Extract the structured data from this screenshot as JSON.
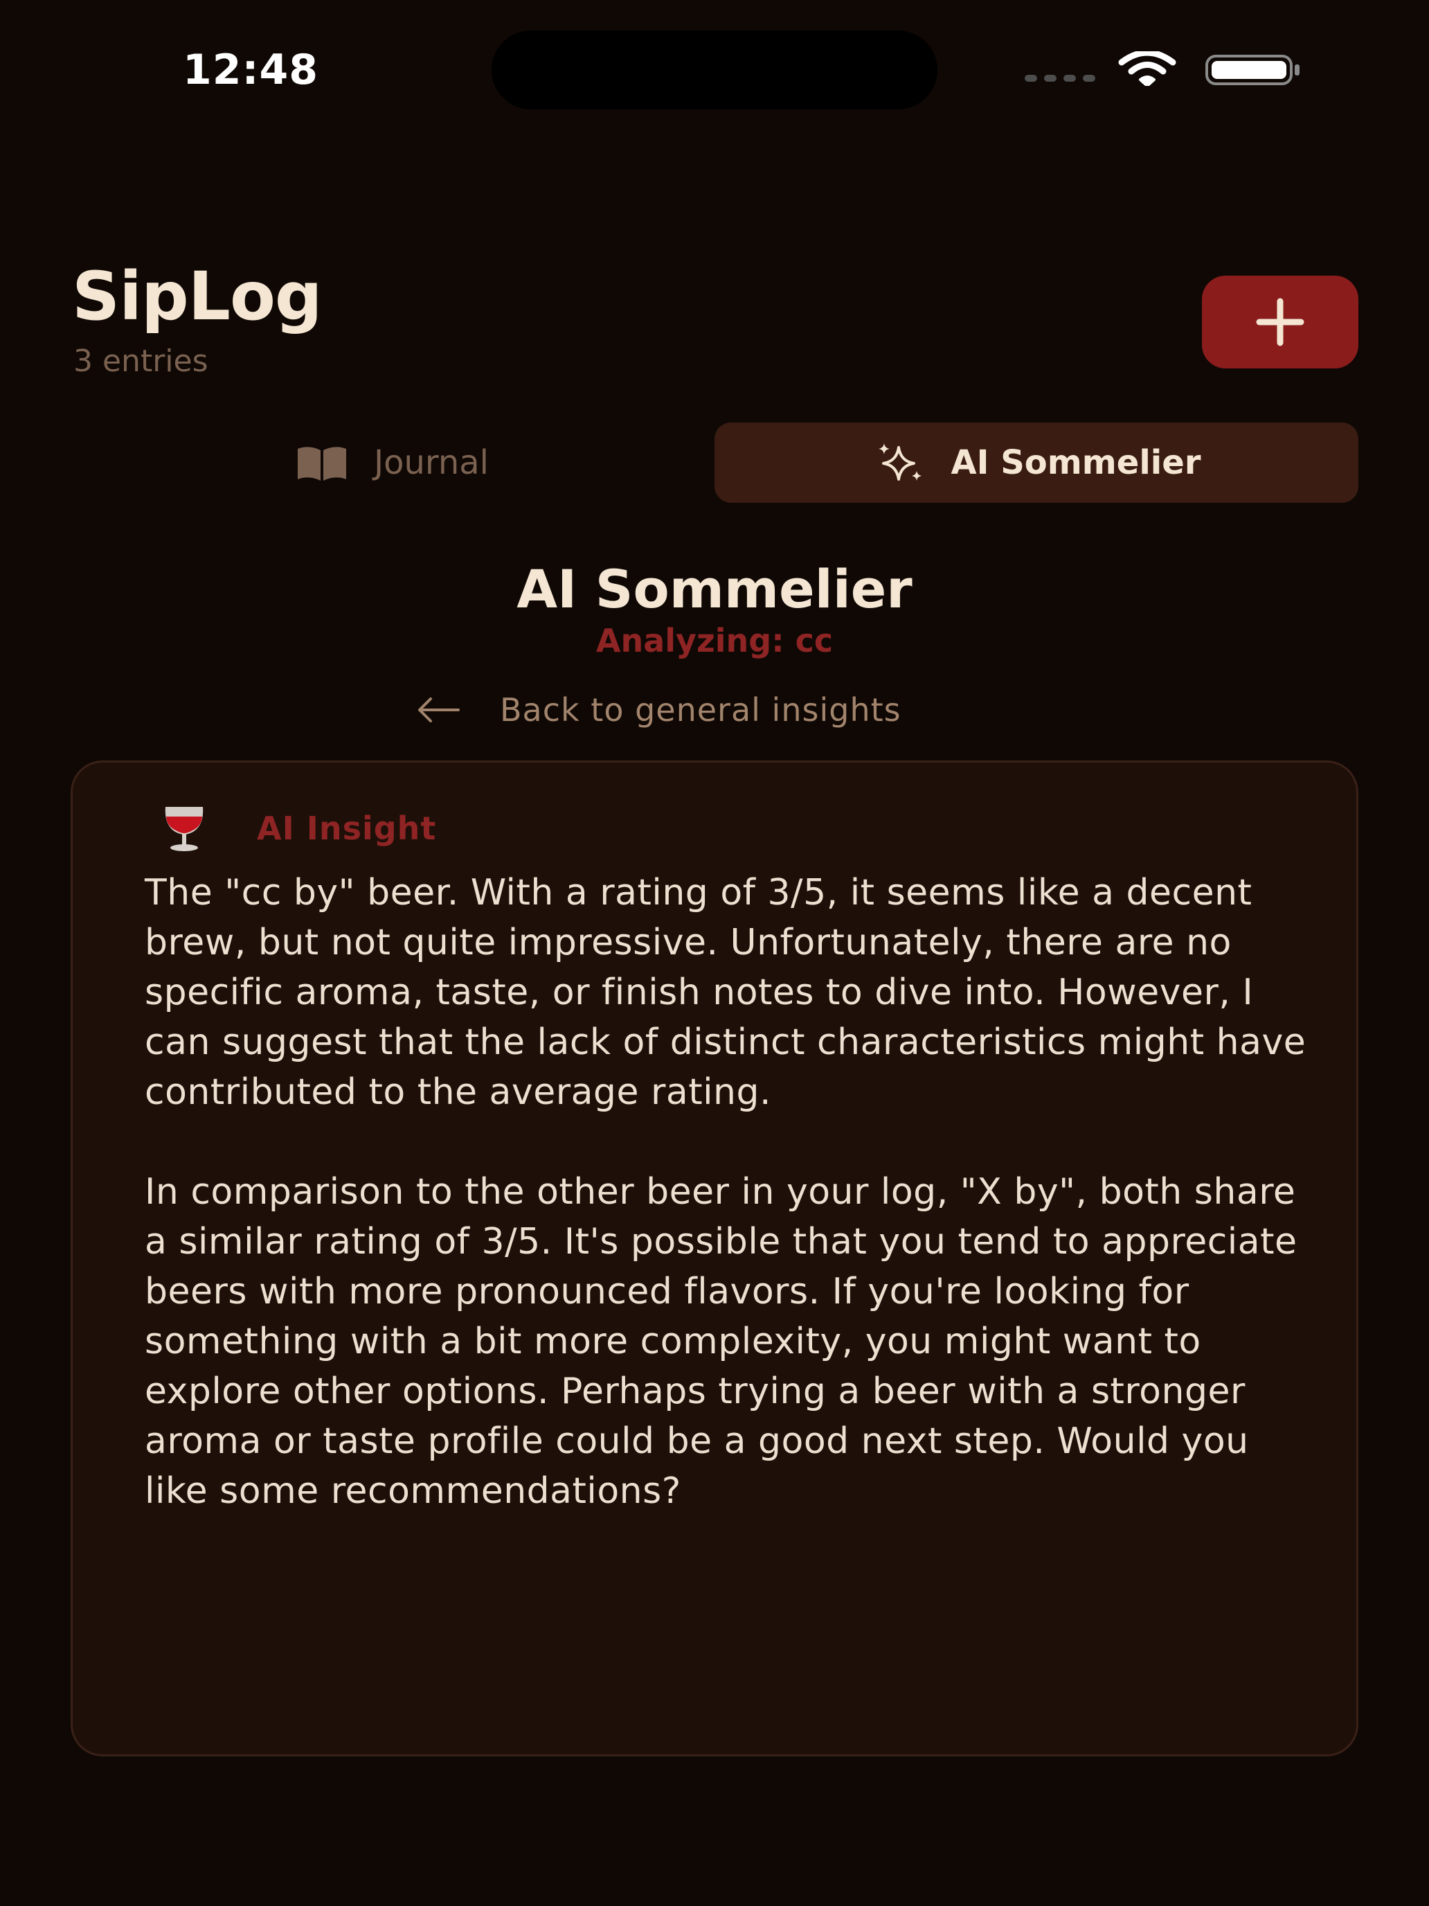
{
  "status_bar": {
    "time": "12:48"
  },
  "header": {
    "title": "SipLog",
    "entry_count": "3 entries"
  },
  "tabs": [
    {
      "label": "Journal",
      "icon": "book-icon",
      "active": false
    },
    {
      "label": "AI Sommelier",
      "icon": "sparkles-icon",
      "active": true
    }
  ],
  "section": {
    "title": "AI Sommelier",
    "subtitle": "Analyzing: cc",
    "back_label": "Back to general insights"
  },
  "insight": {
    "icon": "wine-glass-icon",
    "label": "AI Insight",
    "text": "The \"cc by\" beer. With a rating of 3/5, it seems like a decent brew, but not quite impressive. Unfortunately, there are no specific aroma, taste, or finish notes to dive into. However, I can suggest that the lack of distinct characteristics might have contributed to the average rating.\n\nIn comparison to the other beer in your log, \"X by\", both share a similar rating of 3/5. It's possible that you tend to appreciate beers with more pronounced flavors. If you're looking for something with a bit more complexity, you might want to explore other options. Perhaps trying a beer with a stronger aroma or taste profile could be a good next step. Would you like some recommendations?"
  },
  "colors": {
    "background": "#0f0805",
    "accent": "#8a1c1c",
    "active_tab": "#3a1c12",
    "card": "#1e0f09",
    "text_primary": "#f4e6d2",
    "text_muted": "#7a6150"
  }
}
